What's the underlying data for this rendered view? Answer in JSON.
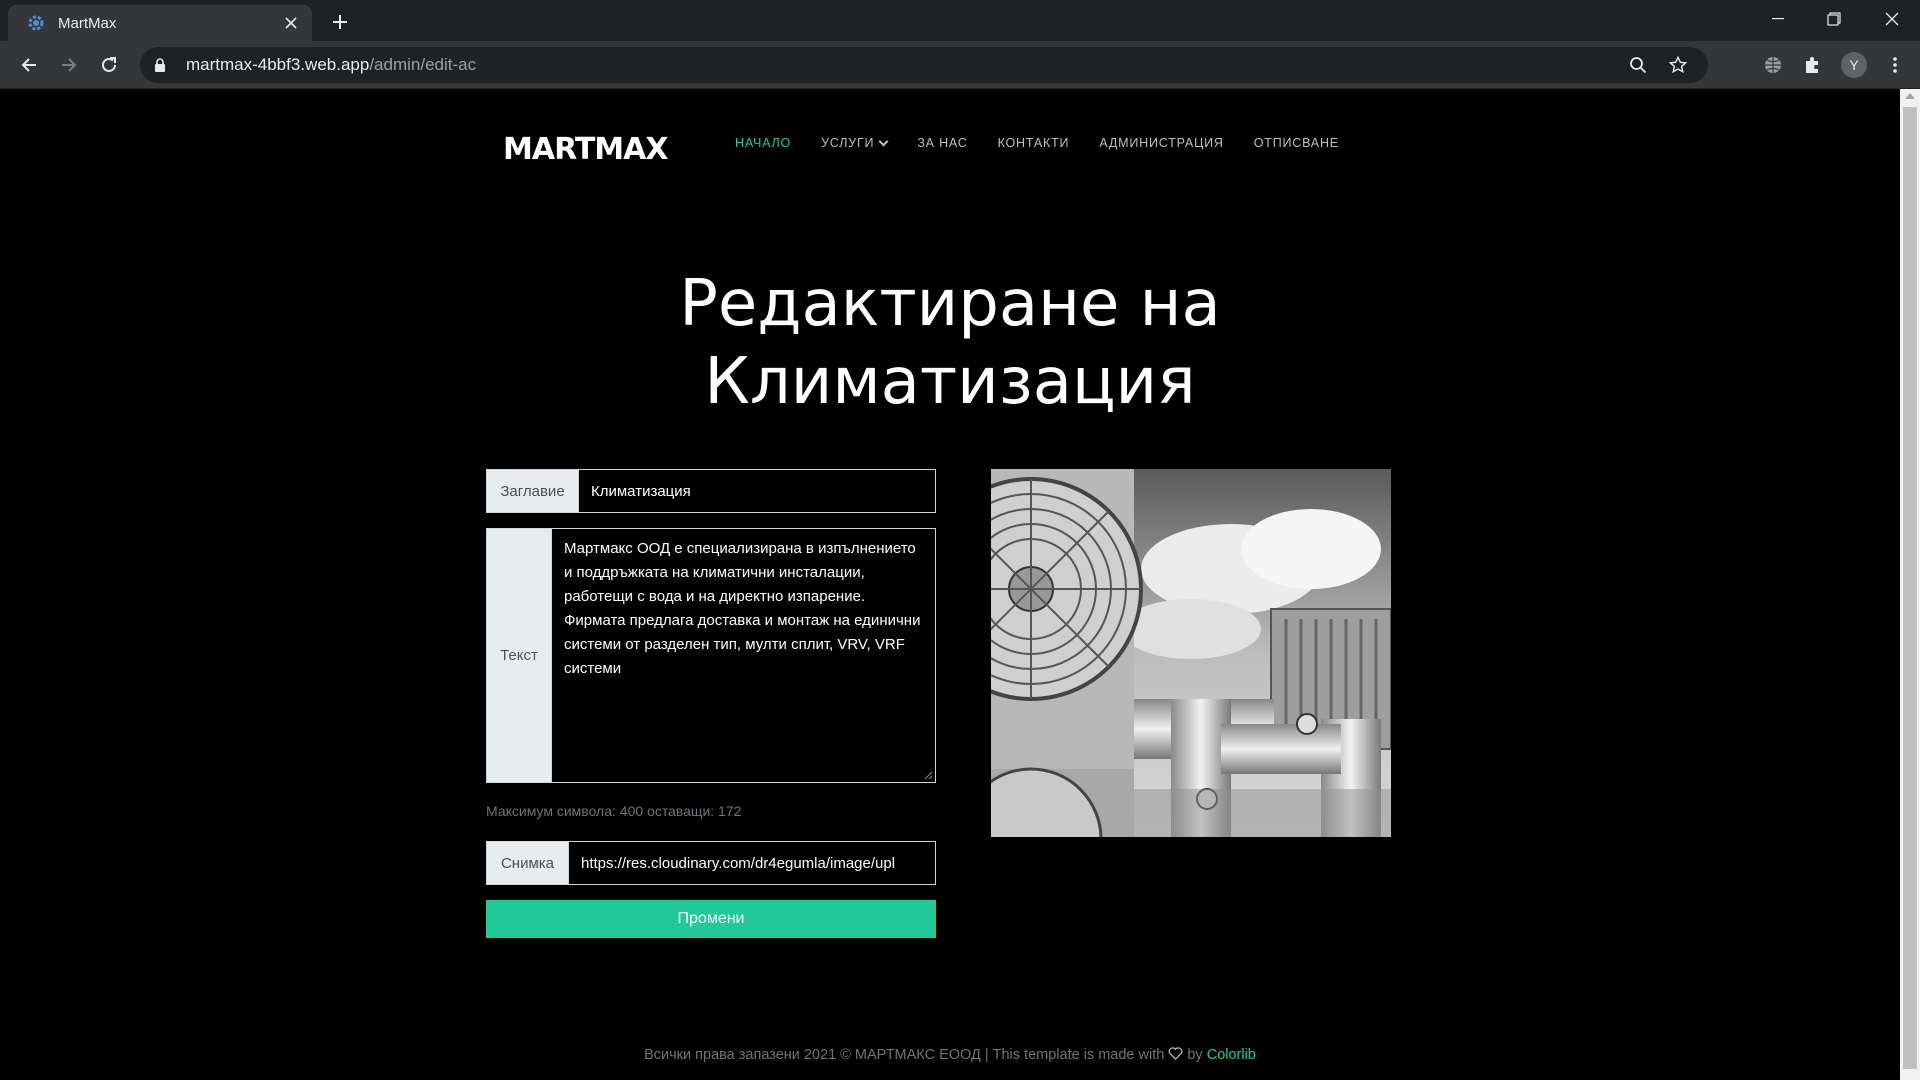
{
  "browser": {
    "tab_title": "MartMax",
    "url_host": "martmax-4bbf3.web.app",
    "url_path": "/admin/edit-ac",
    "profile_initial": "Y"
  },
  "site": {
    "logo": "MARTMAX",
    "nav": [
      {
        "label": "НАЧАЛО",
        "active": true
      },
      {
        "label": "УСЛУГИ",
        "dropdown": true
      },
      {
        "label": "ЗА НАС"
      },
      {
        "label": "КОНТАКТИ"
      },
      {
        "label": "АДМИНИСТРАЦИЯ"
      },
      {
        "label": "ОТПИСВАНЕ"
      }
    ],
    "accent_color": "#20c997"
  },
  "page": {
    "title_line1": "Редактиране на",
    "title_line2": "Климатизация"
  },
  "form": {
    "title_label": "Заглавие",
    "title_value": "Климатизация",
    "text_label": "Текст",
    "text_value": "Мартмакс ООД е специализирана в изпълнението и поддръжката на климатични инсталации, работещи с вода и на директно изпарение. Фирмата предлага доставка и монтаж на единични системи от разделен тип, мулти сплит, VRV, VRF  системи",
    "hint": "Максимум символа: 400 оставащи: 172",
    "image_label": "Снимка",
    "image_value": "https://res.cloudinary.com/dr4egumla/image/upl",
    "submit_label": "Промени"
  },
  "footer": {
    "text": "Всички права запазени 2021 © МАРТМАКС ЕООД | This template is made with",
    "by": "by",
    "link": "Colorlib"
  }
}
